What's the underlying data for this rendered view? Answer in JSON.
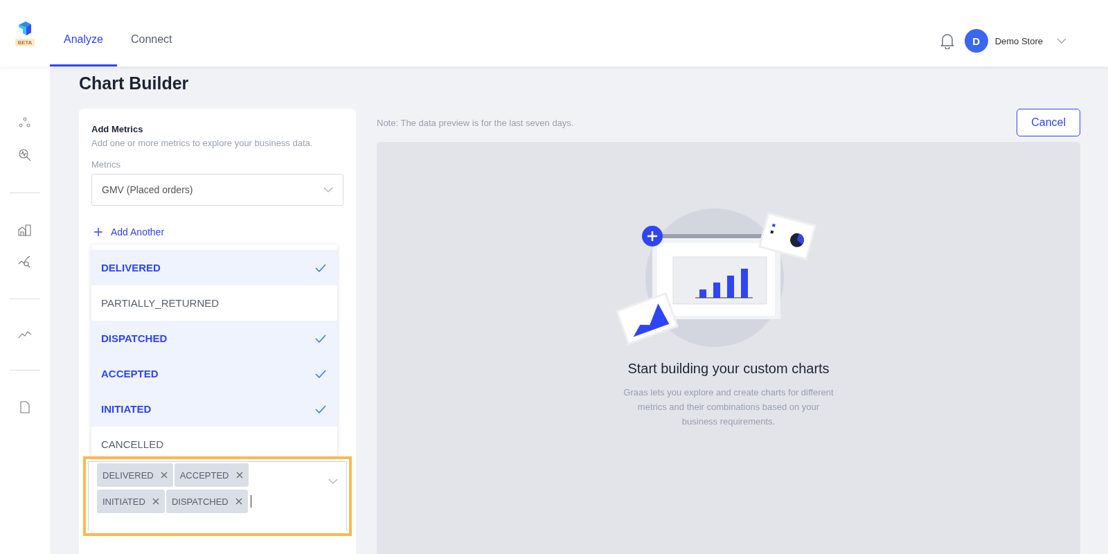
{
  "header": {
    "logo_badge": "BETA",
    "tabs": [
      {
        "label": "Analyze",
        "selected": true
      },
      {
        "label": "Connect",
        "selected": false
      }
    ],
    "user": {
      "avatar_initial": "D",
      "name": "Demo Store"
    }
  },
  "page": {
    "title": "Chart Builder"
  },
  "metrics_panel": {
    "heading": "Add Metrics",
    "description": "Add one or more metrics to explore your business data.",
    "field_label": "Metrics",
    "metric_value": "GMV (Placed orders)",
    "add_another": "Add Another",
    "dropdown_options": [
      {
        "label": "DELIVERED",
        "selected": true
      },
      {
        "label": "PARTIALLY_RETURNED",
        "selected": false
      },
      {
        "label": "DISPATCHED",
        "selected": true
      },
      {
        "label": "ACCEPTED",
        "selected": true
      },
      {
        "label": "INITIATED",
        "selected": true
      },
      {
        "label": "CANCELLED",
        "selected": false
      }
    ],
    "selected_chips": [
      "DELIVERED",
      "ACCEPTED",
      "INITIATED",
      "DISPATCHED"
    ],
    "highlighted": true
  },
  "preview": {
    "note": "Note: The data preview is for the last seven days.",
    "cancel": "Cancel",
    "empty_title": "Start building your custom charts",
    "empty_text": "Graas lets you explore and create charts for different metrics and their combinations based on your business requirements."
  }
}
